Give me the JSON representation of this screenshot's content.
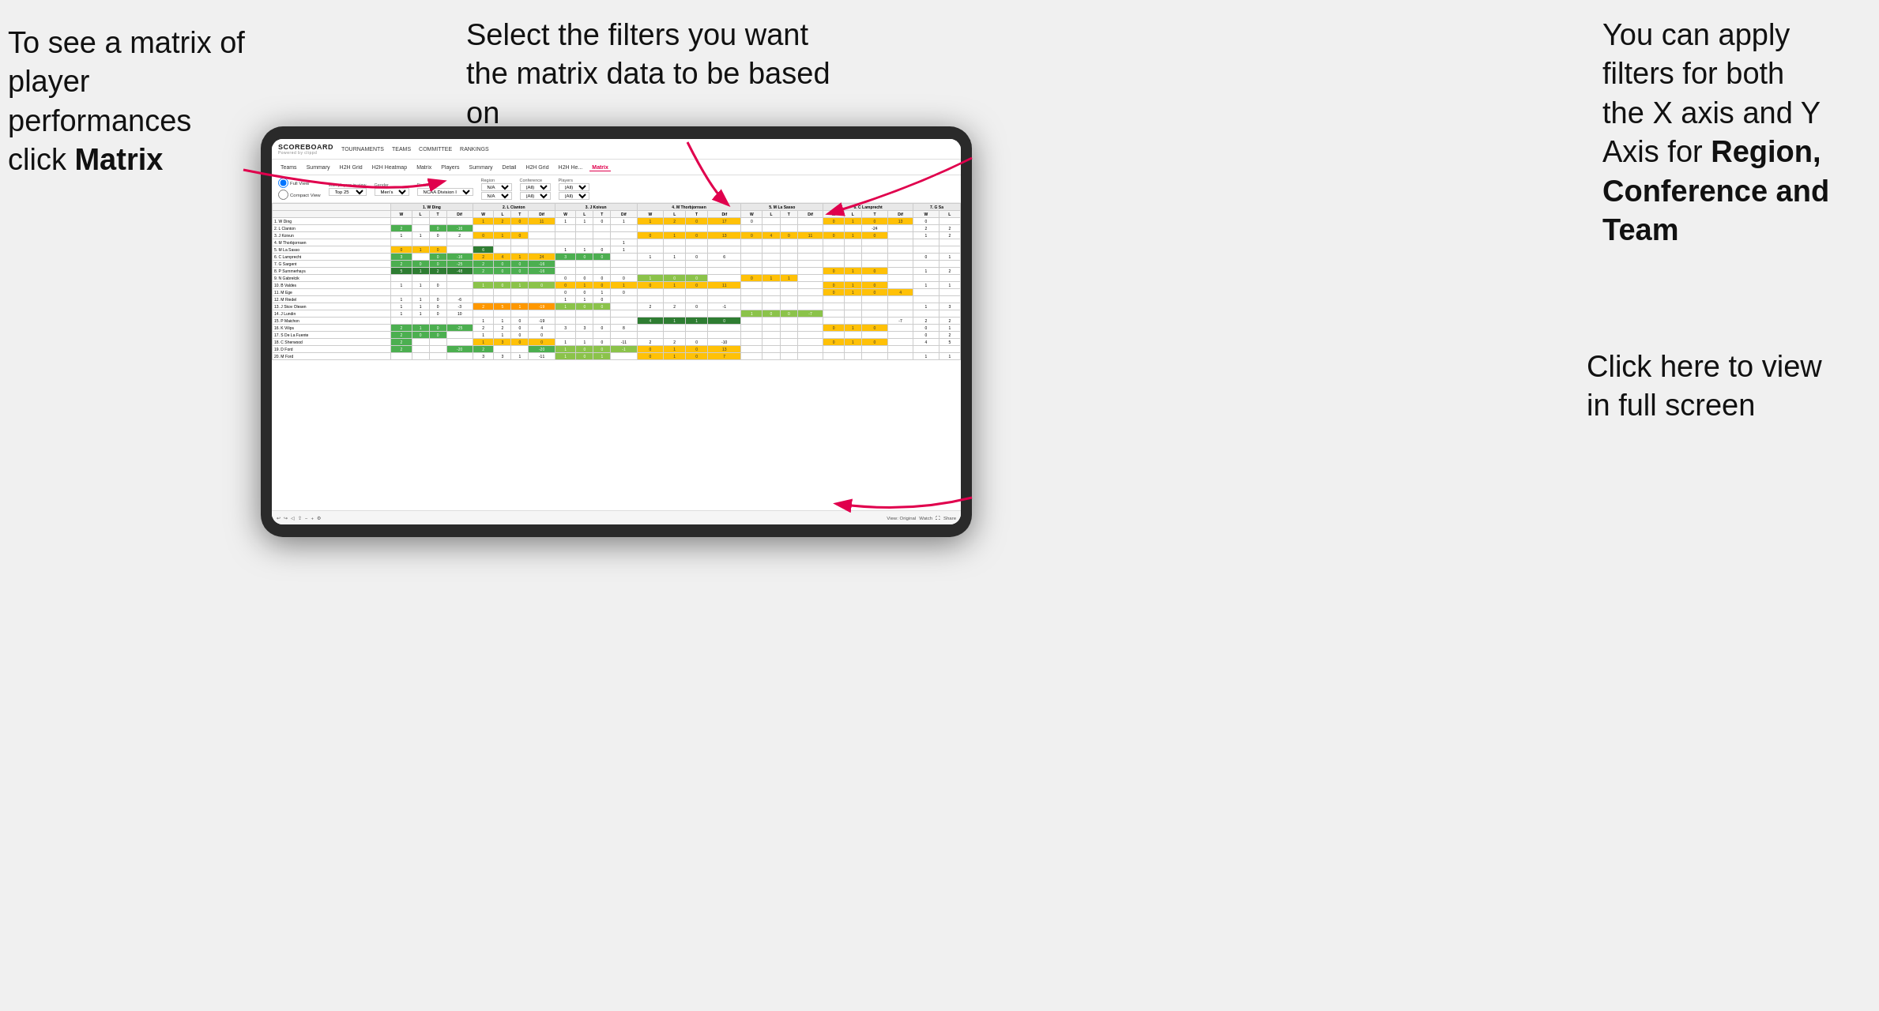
{
  "annotations": {
    "left": {
      "line1": "To see a matrix of",
      "line2": "player performances",
      "line3_prefix": "click ",
      "line3_bold": "Matrix"
    },
    "center": {
      "text": "Select the filters you want the matrix data to be based on"
    },
    "right_top": {
      "line1": "You  can apply",
      "line2": "filters for both",
      "line3": "the X axis and Y",
      "line4_prefix": "Axis for ",
      "line4_bold": "Region,",
      "line5_bold": "Conference and",
      "line6_bold": "Team"
    },
    "right_bottom": {
      "line1": "Click here to view",
      "line2": "in full screen"
    }
  },
  "nav": {
    "logo": "SCOREBOARD",
    "powered_by": "Powered by clippd",
    "items": [
      "TOURNAMENTS",
      "TEAMS",
      "COMMITTEE",
      "RANKINGS"
    ]
  },
  "sub_tabs": {
    "items": [
      "Teams",
      "Summary",
      "H2H Grid",
      "H2H Heatmap",
      "Matrix",
      "Players",
      "Summary",
      "Detail",
      "H2H Grid",
      "H2H He...",
      "Matrix"
    ],
    "active_index": 10
  },
  "filters": {
    "view_options": [
      "Full View",
      "Compact View"
    ],
    "max_players": {
      "label": "Max players in view",
      "value": "Top 25"
    },
    "gender": {
      "label": "Gender",
      "value": "Men's"
    },
    "division": {
      "label": "Division",
      "value": "NCAA Division I"
    },
    "region": {
      "label": "Region",
      "values": [
        "N/A",
        "N/A"
      ]
    },
    "conference": {
      "label": "Conference",
      "values": [
        "(All)",
        "(All)"
      ]
    },
    "players": {
      "label": "Players",
      "values": [
        "(All)",
        "(All)"
      ]
    }
  },
  "matrix": {
    "col_headers": [
      "1. W Ding",
      "2. L Clanton",
      "3. J Koivun",
      "4. M Thorbjornsen",
      "5. M La Sasso",
      "6. C Lamprecht",
      "7. G Sa"
    ],
    "sub_headers": [
      "W",
      "L",
      "T",
      "Dif"
    ],
    "rows": [
      {
        "label": "1. W Ding",
        "data": [
          [
            "",
            "",
            "",
            ""
          ],
          [
            "1",
            "2",
            "0",
            "11"
          ],
          [
            "1",
            "1",
            "0",
            "1"
          ],
          [
            "1",
            "2",
            "0",
            "17"
          ],
          [
            "0",
            "",
            "",
            ""
          ],
          [
            "0",
            "1",
            "0",
            "13"
          ],
          [
            "0",
            ""
          ]
        ]
      },
      {
        "label": "2. L Clanton",
        "data": [
          [
            "2",
            "",
            "0",
            "-16"
          ],
          [
            "",
            "",
            "",
            ""
          ],
          [
            "",
            "",
            "",
            ""
          ],
          [
            "",
            "",
            "",
            ""
          ],
          [
            "",
            "",
            "",
            ""
          ],
          [
            "",
            "",
            "-24",
            ""
          ],
          [
            "2",
            "2"
          ]
        ]
      },
      {
        "label": "3. J Koivun",
        "data": [
          [
            "1",
            "1",
            "0",
            "2"
          ],
          [
            "0",
            "1",
            "0",
            ""
          ],
          [
            "",
            "",
            "",
            ""
          ],
          [
            "0",
            "1",
            "0",
            "13"
          ],
          [
            "0",
            "4",
            "0",
            "11"
          ],
          [
            "0",
            "1",
            "0",
            ""
          ],
          [
            "1",
            "2"
          ]
        ]
      },
      {
        "label": "4. M Thorbjornsen",
        "data": [
          [
            "",
            "",
            "",
            ""
          ],
          [
            "",
            "",
            "",
            ""
          ],
          [
            "",
            "",
            "",
            "1"
          ],
          [
            "",
            "",
            "",
            ""
          ],
          [
            "",
            "",
            "",
            ""
          ],
          [
            "",
            "",
            "",
            ""
          ],
          [
            "",
            ""
          ]
        ]
      },
      {
        "label": "5. M La Sasso",
        "data": [
          [
            "0",
            "1",
            "0",
            ""
          ],
          [
            "6",
            "",
            "",
            ""
          ],
          [
            "1",
            "1",
            "0",
            "1"
          ],
          [
            "",
            "",
            "",
            ""
          ],
          [
            "",
            "",
            "",
            ""
          ],
          [
            "",
            "",
            "",
            ""
          ],
          [
            "",
            ""
          ]
        ]
      },
      {
        "label": "6. C Lamprecht",
        "data": [
          [
            "3",
            "",
            "0",
            "-16"
          ],
          [
            "2",
            "4",
            "1",
            "24"
          ],
          [
            "3",
            "0",
            "0",
            ""
          ],
          [
            "1",
            "1",
            "0",
            "6"
          ],
          [
            "",
            "",
            "",
            ""
          ],
          [
            "",
            "",
            "",
            ""
          ],
          [
            "0",
            "1"
          ]
        ]
      },
      {
        "label": "7. G Sargent",
        "data": [
          [
            "2",
            "0",
            "0",
            "-25"
          ],
          [
            "2",
            "0",
            "0",
            "-16"
          ],
          [
            "",
            "",
            "",
            ""
          ],
          [
            "",
            "",
            "",
            ""
          ],
          [
            "",
            "",
            "",
            ""
          ],
          [
            "",
            "",
            "",
            ""
          ],
          [
            "",
            ""
          ]
        ]
      },
      {
        "label": "8. P Summerhays",
        "data": [
          [
            "5",
            "1",
            "2",
            "-48"
          ],
          [
            "2",
            "0",
            "0",
            "-16"
          ],
          [
            "",
            "",
            "",
            ""
          ],
          [
            "",
            "",
            "",
            ""
          ],
          [
            "",
            "",
            "",
            ""
          ],
          [
            "0",
            "1",
            "0",
            ""
          ],
          [
            "1",
            "2"
          ]
        ]
      },
      {
        "label": "9. N Gabrelcik",
        "data": [
          [
            "",
            "",
            "",
            ""
          ],
          [
            "",
            "",
            "",
            ""
          ],
          [
            "0",
            "0",
            "0",
            "0"
          ],
          [
            "1",
            "0",
            "0",
            ""
          ],
          [
            "0",
            "1",
            "1",
            ""
          ],
          [
            "",
            "",
            "",
            ""
          ],
          [
            "",
            ""
          ]
        ]
      },
      {
        "label": "10. B Valdes",
        "data": [
          [
            "1",
            "1",
            "0",
            ""
          ],
          [
            "1",
            "0",
            "1",
            "0"
          ],
          [
            "0",
            "1",
            "0",
            "1"
          ],
          [
            "0",
            "1",
            "0",
            "11"
          ],
          [
            "",
            "",
            "",
            ""
          ],
          [
            "0",
            "1",
            "0",
            ""
          ],
          [
            "1",
            "1"
          ]
        ]
      },
      {
        "label": "11. M Ege",
        "data": [
          [
            "",
            "",
            "",
            ""
          ],
          [
            "",
            "",
            "",
            ""
          ],
          [
            "0",
            "0",
            "1",
            "0"
          ],
          [
            "",
            "",
            "",
            ""
          ],
          [
            "",
            "",
            "",
            ""
          ],
          [
            "0",
            "1",
            "0",
            "4"
          ],
          [
            "",
            ""
          ]
        ]
      },
      {
        "label": "12. M Riedel",
        "data": [
          [
            "1",
            "1",
            "0",
            "-6"
          ],
          [
            "",
            "",
            "",
            ""
          ],
          [
            "1",
            "1",
            "0",
            ""
          ],
          [
            "",
            "",
            "",
            ""
          ],
          [
            "",
            "",
            "",
            ""
          ],
          [
            "",
            "",
            "",
            ""
          ],
          [
            "",
            ""
          ]
        ]
      },
      {
        "label": "13. J Skov Olesen",
        "data": [
          [
            "1",
            "1",
            "0",
            "-3"
          ],
          [
            "2",
            "5",
            "1",
            "-19"
          ],
          [
            "1",
            "0",
            "0",
            ""
          ],
          [
            "2",
            "2",
            "0",
            "-1"
          ],
          [
            "",
            "",
            "",
            ""
          ],
          [
            "",
            "",
            "",
            ""
          ],
          [
            "1",
            "3"
          ]
        ]
      },
      {
        "label": "14. J Lundin",
        "data": [
          [
            "1",
            "1",
            "0",
            "10"
          ],
          [
            "",
            "",
            "",
            ""
          ],
          [
            "",
            "",
            "",
            ""
          ],
          [
            "",
            "",
            "",
            ""
          ],
          [
            "1",
            "0",
            "0",
            "-7"
          ],
          [
            "",
            "",
            "",
            ""
          ],
          [
            "",
            ""
          ]
        ]
      },
      {
        "label": "15. P Maichon",
        "data": [
          [
            "",
            "",
            "",
            ""
          ],
          [
            "1",
            "1",
            "0",
            "-19"
          ],
          [
            "",
            "",
            "",
            ""
          ],
          [
            "4",
            "1",
            "1",
            "0"
          ],
          [
            "",
            "",
            "",
            ""
          ],
          [
            "",
            "",
            "",
            "-7"
          ],
          [
            "2",
            "2"
          ]
        ]
      },
      {
        "label": "16. K Vilips",
        "data": [
          [
            "2",
            "1",
            "0",
            "-25"
          ],
          [
            "2",
            "2",
            "0",
            "4"
          ],
          [
            "3",
            "3",
            "0",
            "8"
          ],
          [
            "",
            "",
            "",
            ""
          ],
          [
            "",
            "",
            "",
            ""
          ],
          [
            "0",
            "1",
            "0",
            ""
          ],
          [
            "0",
            "1"
          ]
        ]
      },
      {
        "label": "17. S De La Fuente",
        "data": [
          [
            "2",
            "0",
            "0",
            ""
          ],
          [
            "1",
            "1",
            "0",
            "0"
          ],
          [
            "",
            "",
            "",
            ""
          ],
          [
            "",
            "",
            "",
            ""
          ],
          [
            "",
            "",
            "",
            ""
          ],
          [
            "",
            "",
            "",
            ""
          ],
          [
            "0",
            "2"
          ]
        ]
      },
      {
        "label": "18. C Sherwood",
        "data": [
          [
            "2",
            "",
            "",
            ""
          ],
          [
            "1",
            "3",
            "0",
            "0"
          ],
          [
            "1",
            "1",
            "0",
            "-11"
          ],
          [
            "2",
            "2",
            "0",
            "-10"
          ],
          [
            "",
            "",
            "",
            ""
          ],
          [
            "0",
            "1",
            "0",
            ""
          ],
          [
            "4",
            "5"
          ]
        ]
      },
      {
        "label": "19. D Ford",
        "data": [
          [
            "2",
            "",
            "",
            "-20"
          ],
          [
            "2",
            "",
            "",
            "-20"
          ],
          [
            "1",
            "0",
            "0",
            "-1"
          ],
          [
            "0",
            "1",
            "0",
            "13"
          ],
          [
            "",
            "",
            "",
            ""
          ],
          [
            "",
            "",
            "",
            ""
          ],
          [
            "",
            ""
          ]
        ]
      },
      {
        "label": "20. M Ford",
        "data": [
          [
            "",
            "",
            "",
            ""
          ],
          [
            "3",
            "3",
            "1",
            "-11"
          ],
          [
            "1",
            "0",
            "1",
            ""
          ],
          [
            "0",
            "1",
            "0",
            "7"
          ],
          [
            "",
            "",
            "",
            ""
          ],
          [
            "",
            "",
            "",
            ""
          ],
          [
            "1",
            "1"
          ]
        ]
      }
    ]
  },
  "toolbar": {
    "view_label": "View: Original",
    "watch_label": "Watch",
    "share_label": "Share"
  },
  "colors": {
    "accent": "#e0004d",
    "green_dark": "#2e7d32",
    "green": "#4caf50",
    "yellow": "#ffc107",
    "orange": "#ff9800"
  }
}
